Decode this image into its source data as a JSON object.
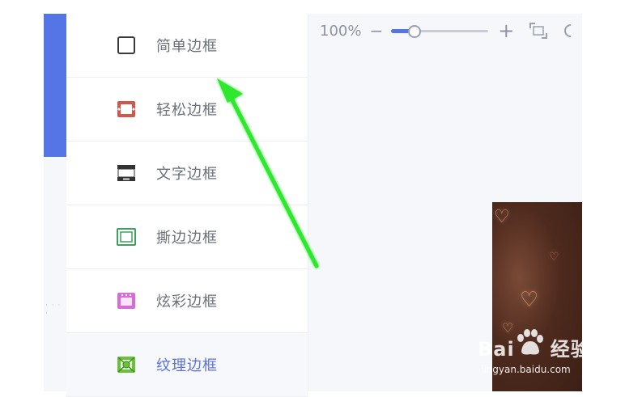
{
  "toolbar": {
    "zoom_level": "100%",
    "minus_label": "−",
    "plus_label": "+",
    "zoom_fraction": 0.22
  },
  "frames": {
    "items": [
      {
        "label": "简单边框",
        "icon": "simple-frame-icon",
        "color": "#3a3a3a"
      },
      {
        "label": "轻松边框",
        "icon": "easy-frame-icon",
        "color": "#d2574a"
      },
      {
        "label": "文字边框",
        "icon": "text-frame-icon",
        "color": "#333333"
      },
      {
        "label": "撕边边框",
        "icon": "torn-edge-frame-icon",
        "color": "#3fa05d"
      },
      {
        "label": "炫彩边框",
        "icon": "colorful-frame-icon",
        "color": "#d76bd7"
      },
      {
        "label": "纹理边框",
        "icon": "texture-frame-icon",
        "color": "#6cc13a"
      }
    ],
    "active_index": 5
  },
  "watermark": {
    "brand": "Bai",
    "suffix": "经验",
    "url": "jingyan.baidu.com"
  },
  "colors": {
    "accent": "#5575e7",
    "arrow": "#2ee82e"
  }
}
